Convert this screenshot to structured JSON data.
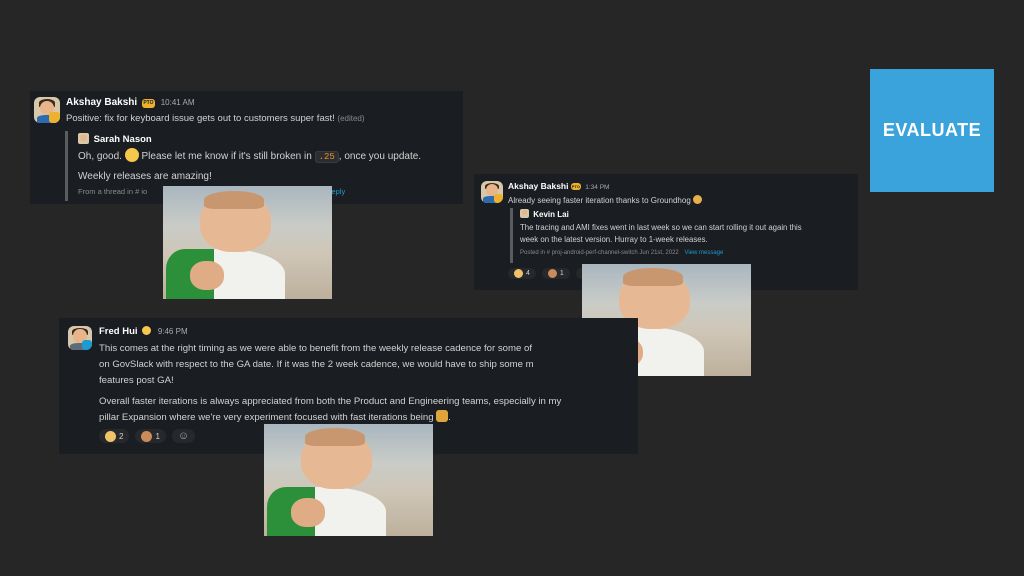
{
  "evaluate_badge": "EVALUATE",
  "message1": {
    "author": "Akshay Bakshi",
    "status": "PTO",
    "time": "10:41 AM",
    "text": "Positive: fix for keyboard issue gets out to customers super fast!",
    "edited": "(edited)",
    "quote": {
      "author": "Sarah Nason",
      "line1_before": "Oh, good.",
      "line1_after": "Please let me know if it's still broken in",
      "code": ".25",
      "line1_end": ", once you update.",
      "line2": "Weekly releases are amazing!",
      "meta_prefix": "From a thread in # io",
      "meta_link": "reply"
    }
  },
  "message2": {
    "author": "Akshay Bakshi",
    "status": "PTO",
    "time": "1:34 PM",
    "text": "Already seeing faster iteration thanks to Groundhog",
    "quote": {
      "author": "Kevin Lai",
      "line1": "The tracing and AMI fixes went in last week so we can start rolling it out again this",
      "line2": "week on the latest version. Hurray to 1-week releases.",
      "meta": "Posted in # proj-android-perf-channel-switch   Jun 21st, 2022",
      "meta_link": "View message"
    },
    "reactions": [
      {
        "icon": "raised-hands-emoji",
        "count": "4"
      },
      {
        "icon": "party-emoji",
        "count": "1"
      },
      {
        "icon": "thumbs-emoji",
        "count": "1"
      }
    ]
  },
  "message3": {
    "author": "Fred Hui",
    "time": "9:46 PM",
    "p1_l1": "This comes at the right timing as we were able to benefit from the weekly release cadence for some of",
    "p1_l2": "on GovSlack with respect to the GA date. If it was the 2 week cadence, we would have to ship some m",
    "p1_l3": "features post GA!",
    "p2_l1": "Overall faster iterations is always appreciated from both the Product and Engineering teams, especially in my",
    "p2_l2": "pillar Expansion where we're very experiment focused with fast iterations being",
    "p2_end": ".",
    "reactions": [
      {
        "icon": "raised-hands-emoji",
        "count": "2"
      },
      {
        "icon": "party-emoji",
        "count": "1"
      }
    ]
  }
}
